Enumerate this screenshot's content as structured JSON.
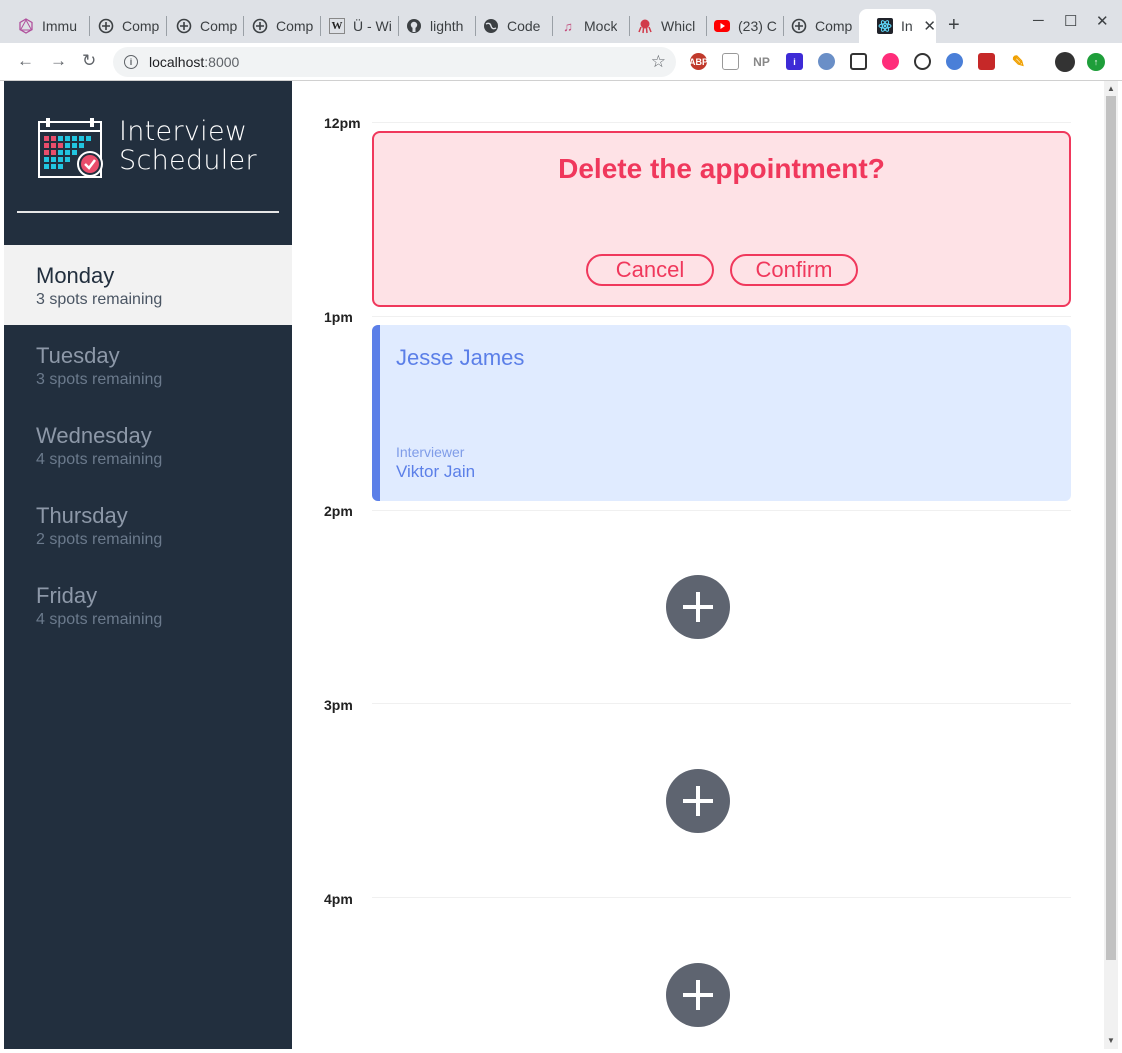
{
  "browser": {
    "tabs": [
      {
        "title": "Immu",
        "icon": "graphql-icon"
      },
      {
        "title": "Comp",
        "icon": "compass-icon"
      },
      {
        "title": "Comp",
        "icon": "compass-icon"
      },
      {
        "title": "Comp",
        "icon": "compass-icon"
      },
      {
        "title": "Ü - Wi",
        "icon": "wikipedia-icon"
      },
      {
        "title": "lighth",
        "icon": "github-icon"
      },
      {
        "title": "Code",
        "icon": "globe-icon"
      },
      {
        "title": "Mock",
        "icon": "music-icon"
      },
      {
        "title": "Whicl",
        "icon": "octopus-icon"
      },
      {
        "title": "(23) C",
        "icon": "youtube-icon"
      },
      {
        "title": "Comp",
        "icon": "compass-icon"
      },
      {
        "title": "Int",
        "icon": "react-icon"
      }
    ],
    "active_tab_index": 11,
    "new_tab_glyph": "+",
    "address": {
      "host": "localhost",
      "port": ":8000"
    },
    "extensions": [
      "ABP",
      "",
      "NP",
      "i",
      "",
      "",
      "",
      "",
      "",
      "",
      "",
      ""
    ]
  },
  "app": {
    "brand": {
      "line1": "Interview",
      "line2": "Scheduler"
    },
    "days": [
      {
        "name": "Monday",
        "spots": "3 spots remaining",
        "selected": true
      },
      {
        "name": "Tuesday",
        "spots": "3 spots remaining",
        "selected": false
      },
      {
        "name": "Wednesday",
        "spots": "4 spots remaining",
        "selected": false
      },
      {
        "name": "Thursday",
        "spots": "2 spots remaining",
        "selected": false
      },
      {
        "name": "Friday",
        "spots": "4 spots remaining",
        "selected": false
      }
    ],
    "times": [
      "12pm",
      "1pm",
      "2pm",
      "3pm",
      "4pm"
    ],
    "confirm": {
      "message": "Delete the appointment?",
      "cancel_label": "Cancel",
      "confirm_label": "Confirm"
    },
    "appointment": {
      "student": "Jesse James",
      "interviewer_label": "Interviewer",
      "interviewer_name": "Viktor Jain"
    }
  },
  "colors": {
    "sidebar": "#222f3e",
    "danger": "#f0385c",
    "danger_bg": "#fee2e6",
    "appointment_accent": "#5b7fe8",
    "appointment_bg": "#e0ebff",
    "add_button": "#5e6470"
  }
}
